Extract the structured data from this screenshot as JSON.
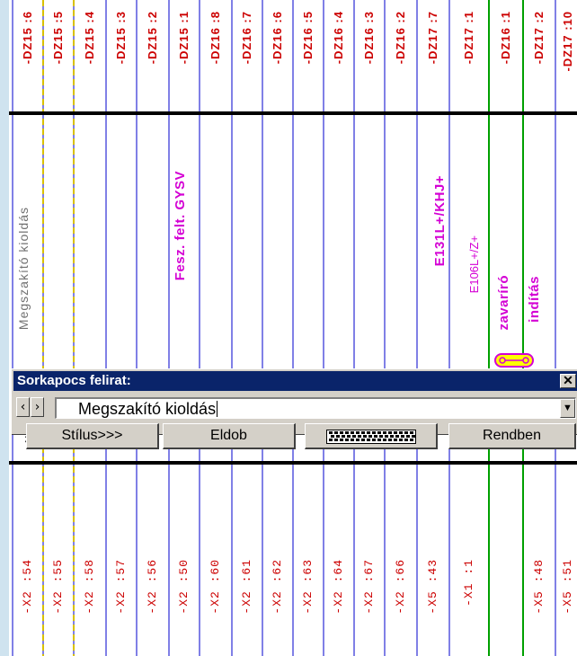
{
  "sheet": {
    "top_labels": [
      "-DZ15 :6",
      "-DZ15 :5",
      "-DZ15 :4",
      "-DZ15 :3",
      "-DZ15 :2",
      "-DZ15 :1",
      "-DZ16 :8",
      "-DZ16 :7",
      "-DZ16 :6",
      "-DZ16 :5",
      "-DZ16 :4",
      "-DZ16 :3",
      "-DZ16 :2",
      "-DZ17 :7",
      "-DZ17 :1",
      "-DZ16 :1",
      "-DZ17 :2",
      "-DZ17 :10"
    ],
    "bottom_labels": [
      "-X2 :54",
      "-X2 :55",
      "-X2 :58",
      "-X2 :57",
      "-X2 :56",
      "-X2 :50",
      "-X2 :60",
      "-X2 :61",
      "-X2 :62",
      "-X2 :63",
      "-X2 :64",
      "-X2 :67",
      "-X2 :66",
      "-X5 :43",
      "-X1 :1",
      "",
      "-X5 :48",
      "-X5 :51"
    ],
    "terminal_digits": [
      "3",
      "3",
      "3",
      "3",
      "3",
      "3",
      "3",
      "3",
      "4",
      "4",
      "4",
      "4",
      "4",
      "4",
      "4",
      "4",
      "4",
      "4"
    ],
    "descriptions": {
      "megszakito": "Megszakító kioldás",
      "fesz": "Fesz. felt. GYSV",
      "e131": "E131L+/KHJ+",
      "e106": "E106L+/Z+",
      "zavariro": "zavaríró",
      "inditas": "indítás"
    }
  },
  "dialog": {
    "title": "Sorkapocs felirat:",
    "close_glyph": "✕",
    "prev_glyph": "‹",
    "next_glyph": "›",
    "input_value": "Megszakító kioldás",
    "dropdown_glyph": "▼",
    "buttons": {
      "style": "Stílus>>>",
      "discard": "Eldob",
      "ok": "Rendben"
    }
  },
  "colors": {
    "label_red": "#cc0000",
    "line_blue": "#0000cc",
    "desc_magenta": "#d400d4",
    "green_line": "#00a000",
    "yellow_dash": "#d8c000",
    "titlebar": "#0a246a",
    "dialog_bg": "#d4d0c8",
    "frame": "#cfe3ef"
  },
  "icons": [
    "close-icon",
    "chevron-left-icon",
    "chevron-right-icon",
    "dropdown-arrow-icon",
    "keyboard-icon",
    "fuse-symbol-icon"
  ]
}
